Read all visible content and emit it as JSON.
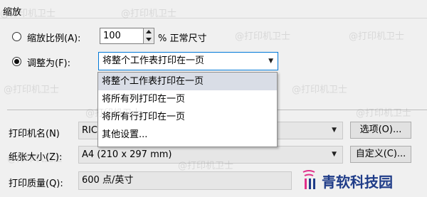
{
  "section_title": "缩放",
  "scale": {
    "radio1_label": "缩放比例(A):",
    "percent_value": "100",
    "percent_suffix": "% 正常尺寸",
    "radio2_label": "调整为(F):",
    "fit_selected": "将整个工作表打印在一页",
    "selected_option": "fit"
  },
  "dropdown": {
    "options": [
      "将整个工作表打印在一页",
      "将所有列打印在一页",
      "将所有行打印在一页",
      "其他设置..."
    ],
    "highlighted_index": 0
  },
  "printer": {
    "label": "打印机名(N)",
    "value_visible": "RIC",
    "options_button": "选项(O)..."
  },
  "paper": {
    "label": "纸张大小(Z):",
    "value": "A4 (210 x 297 mm)",
    "custom_button": "自定义(C)..."
  },
  "quality": {
    "label": "打印质量(Q):",
    "value": "600 点/英寸"
  },
  "watermark": {
    "text": "@打印机卫士",
    "logo_text": "青软科技园"
  },
  "colors": {
    "accent_border": "#0078d7",
    "highlight": "#d9dde6",
    "logo_blue": "#1f3c88",
    "logo_pink": "#e0308a"
  }
}
